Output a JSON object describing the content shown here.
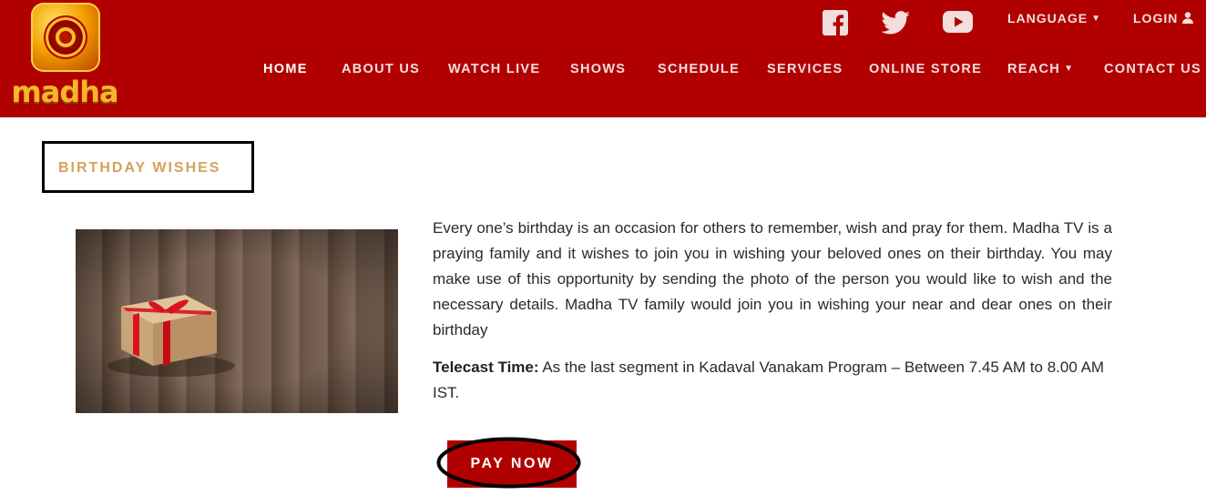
{
  "brand": {
    "logo_text": "madha"
  },
  "header": {
    "language_label": "LANGUAGE",
    "login_label": "LOGIN",
    "social": [
      "facebook-icon",
      "twitter-icon",
      "youtube-icon"
    ]
  },
  "nav": {
    "items": [
      {
        "label": "HOME",
        "active": true
      },
      {
        "label": "ABOUT US"
      },
      {
        "label": "WATCH LIVE"
      },
      {
        "label": "SHOWS"
      },
      {
        "label": "SCHEDULE"
      },
      {
        "label": "SERVICES"
      },
      {
        "label": "ONLINE STORE"
      },
      {
        "label": "REACH",
        "has_dropdown": true
      },
      {
        "label": "CONTACT US"
      }
    ]
  },
  "page": {
    "title": "BIRTHDAY WISHES",
    "description": "Every one’s birthday is an occasion for others to remember, wish and pray for them. Madha TV is a praying family and it wishes to join you in wishing your beloved ones on their birthday. You may make use of this opportunity by sending the photo of the person you would like to wish and the necessary details. Madha TV family would join you in wishing your near and dear ones on their birthday",
    "telecast_label": "Telecast Time:",
    "telecast_text": " As the last segment in Kadaval Vanakam Program – Between 7.45 AM to 8.00 AM IST.",
    "pay_button": "PAY NOW"
  },
  "colors": {
    "brand_red": "#b10000",
    "title_gold": "#d6a25a"
  }
}
